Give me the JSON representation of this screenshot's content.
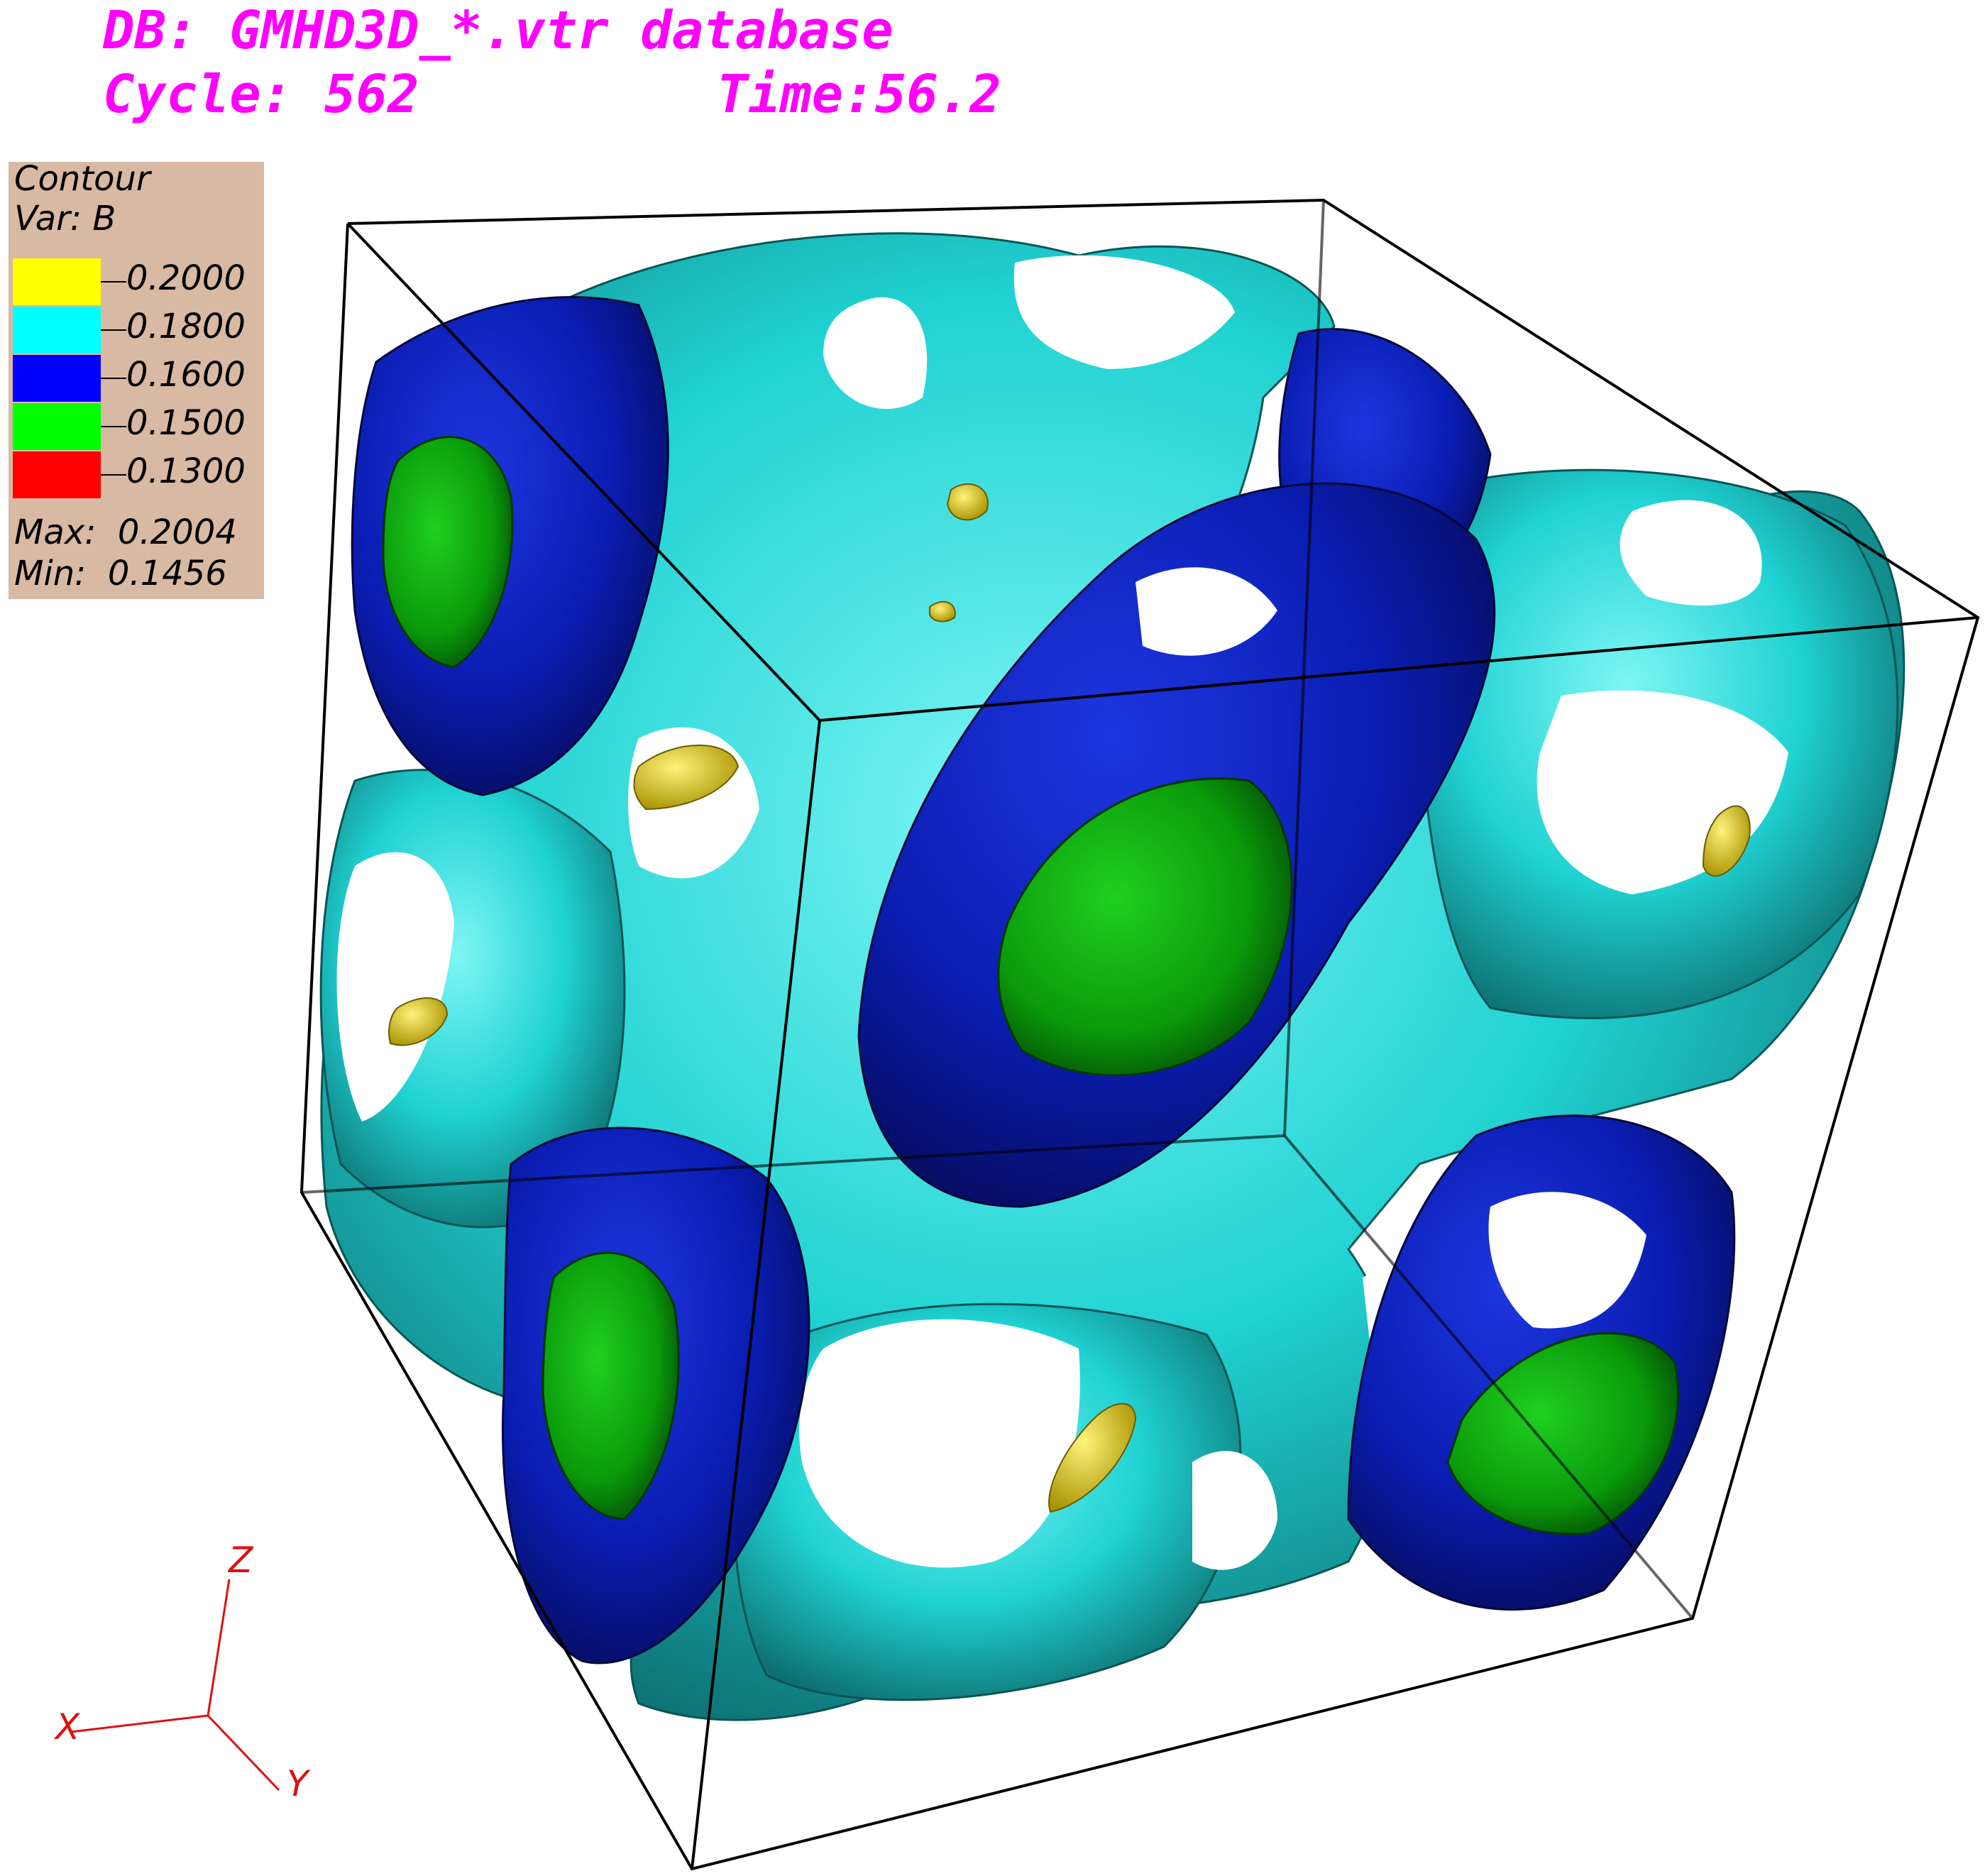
{
  "header": {
    "db_line": "DB: GMHD3D_*.vtr database",
    "cycle_line": "Cycle: 562",
    "time_line": "Time:56.2"
  },
  "legend": {
    "title": "Contour",
    "var_label": "Var: B",
    "entries": [
      {
        "value": "0.2000",
        "color": "#ffff00"
      },
      {
        "value": "0.1800",
        "color": "#00ffff"
      },
      {
        "value": "0.1600",
        "color": "#0000ff"
      },
      {
        "value": "0.1500",
        "color": "#00ff00"
      },
      {
        "value": "0.1300",
        "color": "#ff0000"
      }
    ],
    "max_label": "Max:  0.2004",
    "min_label": "Min:  0.1456"
  },
  "triad": {
    "x_label": "X",
    "y_label": "Y",
    "z_label": "Z",
    "color": "#dd1010"
  },
  "colors": {
    "text_accent": "#ff00ff",
    "legend_bg": "#d8b9a3",
    "surface_cyan": "#2fd6d6",
    "surface_blue": "#0a1aa0",
    "surface_green": "#0c9a0c",
    "surface_yellow": "#e0d000"
  }
}
